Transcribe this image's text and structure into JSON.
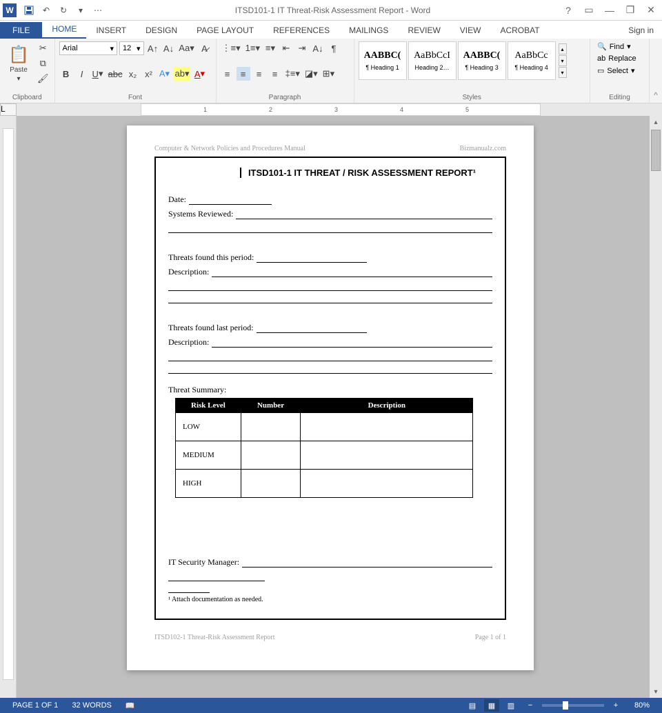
{
  "titlebar": {
    "doc_title": "ITSD101-1 IT Threat-Risk Assessment Report - Word",
    "help": "?",
    "ribbon_opts": "▭",
    "minimize": "—",
    "restore": "❐",
    "close": "✕"
  },
  "tabs": {
    "file": "FILE",
    "home": "HOME",
    "insert": "INSERT",
    "design": "DESIGN",
    "page_layout": "PAGE LAYOUT",
    "references": "REFERENCES",
    "mailings": "MAILINGS",
    "review": "REVIEW",
    "view": "VIEW",
    "acrobat": "ACROBAT",
    "signin": "Sign in"
  },
  "ribbon": {
    "clipboard": {
      "label": "Clipboard",
      "paste": "Paste"
    },
    "font": {
      "label": "Font",
      "name": "Arial",
      "size": "12"
    },
    "paragraph": {
      "label": "Paragraph"
    },
    "styles": {
      "label": "Styles",
      "items": [
        {
          "sample": "AABBC(",
          "name": "¶ Heading 1"
        },
        {
          "sample": "AaBbCcI",
          "name": "Heading 2…"
        },
        {
          "sample": "AABBC(",
          "name": "¶ Heading 3"
        },
        {
          "sample": "AaBbCc",
          "name": "¶ Heading 4"
        }
      ]
    },
    "editing": {
      "label": "Editing",
      "find": "Find",
      "replace": "Replace",
      "select": "Select"
    }
  },
  "ruler": {
    "marks": [
      "1",
      "2",
      "3",
      "4",
      "5"
    ]
  },
  "doc": {
    "header_left": "Computer & Network Policies and Procedures Manual",
    "header_right": "Bizmanualz.com",
    "title": "ITSD101-1   IT THREAT / RISK ASSESSMENT REPORT¹",
    "date_label": "Date:",
    "systems_label": "Systems Reviewed:",
    "threats_this_label": "Threats found this period:",
    "desc_label": "Description:",
    "threats_last_label": "Threats found last period:",
    "summary_label": "Threat Summary:",
    "table": {
      "headers": [
        "Risk Level",
        "Number",
        "Description"
      ],
      "rows": [
        "LOW",
        "MEDIUM",
        "HIGH"
      ]
    },
    "manager_label": "IT Security Manager:",
    "footnote": "¹ Attach documentation as needed.",
    "footer_left": "ITSD102-1 Threat-Risk Assessment Report",
    "footer_right": "Page 1 of 1"
  },
  "status": {
    "page": "PAGE 1 OF 1",
    "words": "32 WORDS",
    "zoom": "80%"
  }
}
